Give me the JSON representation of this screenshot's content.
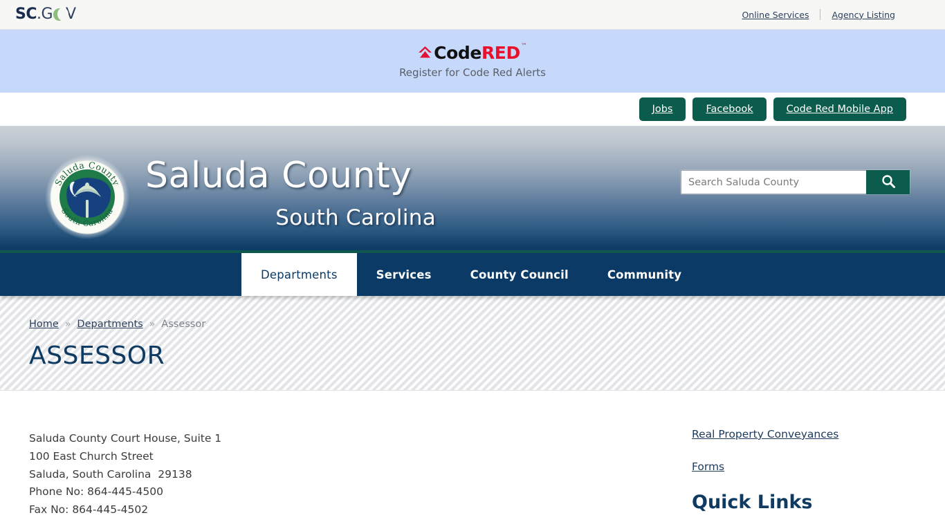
{
  "topbar": {
    "logo": {
      "sc": "SC",
      "dot_g": ".G",
      "moon_icon": "crescent-moon-icon",
      "v": "V"
    },
    "links": [
      {
        "label": "Online Services"
      },
      {
        "label": "Agency Listing"
      }
    ]
  },
  "codered": {
    "icon": "codered-triangle-icon",
    "word_code": "Code",
    "word_red": "RED",
    "tm": "™",
    "subtitle": "Register for Code Red Alerts",
    "background_color": "#c6d9fb",
    "red_color": "#e8102a"
  },
  "buttons": [
    {
      "label": "Jobs"
    },
    {
      "label": "Facebook"
    },
    {
      "label": "Code Red Mobile App"
    }
  ],
  "hero": {
    "seal": {
      "icon": "county-seal-icon",
      "top_text": "Saluda County",
      "bottom_text": "South Carolina"
    },
    "title": "Saluda County",
    "subtitle": "South Carolina",
    "accent_color": "#11594f"
  },
  "search": {
    "placeholder": "Search Saluda County",
    "value": "",
    "button_icon": "search-icon",
    "button_color": "#0b5c4c"
  },
  "nav": {
    "background_color": "#0b3a66",
    "items": [
      {
        "label": "Departments",
        "active": true
      },
      {
        "label": "Services",
        "active": false
      },
      {
        "label": "County Council",
        "active": false
      },
      {
        "label": "Community",
        "active": false
      }
    ]
  },
  "breadcrumb": {
    "separator": "»",
    "items": [
      {
        "label": "Home",
        "link": true
      },
      {
        "label": "Departments",
        "link": true
      },
      {
        "label": "Assessor",
        "link": false
      }
    ]
  },
  "page": {
    "title": "ASSESSOR",
    "title_color": "#0f3a62"
  },
  "main": {
    "address": [
      "Saluda County Court House, Suite 1",
      "100 East Church Street",
      "Saluda, South Carolina  29138",
      "Phone No: 864-445-4500",
      "Fax No: 864-445-4502"
    ]
  },
  "sidebar": {
    "links": [
      {
        "label": "Real Property Conveyances"
      },
      {
        "label": "Forms"
      }
    ],
    "heading": "Quick Links"
  }
}
